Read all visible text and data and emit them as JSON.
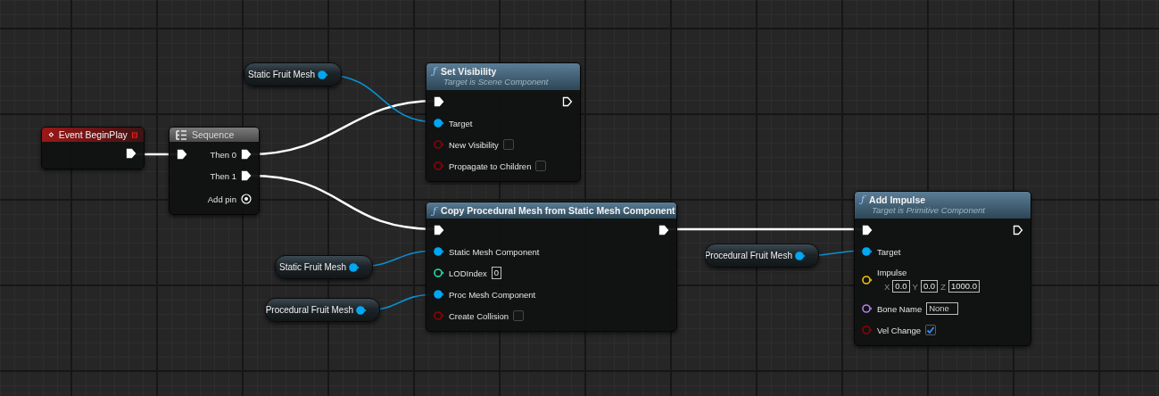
{
  "nodes": [
    {
      "kind": "variable",
      "title": "Static Fruit Mesh",
      "outputs": [
        {
          "kind": "object",
          "connected": true
        }
      ]
    },
    {
      "kind": "function",
      "icon_glyph": "ƒ",
      "title": "Set Visibility",
      "subtitle": "Target is Scene Component",
      "inputs": [
        {
          "kind": "exec",
          "connected": true
        },
        {
          "kind": "object",
          "label": "Target",
          "connected": true
        },
        {
          "kind": "bool",
          "label": "New Visibility",
          "connected": false,
          "checked": false
        },
        {
          "kind": "bool",
          "label": "Propagate to Children",
          "connected": false,
          "checked": false
        }
      ],
      "outputs": [
        {
          "kind": "exec",
          "connected": false
        }
      ]
    },
    {
      "kind": "event",
      "title": "Event BeginPlay",
      "outputs": [
        {
          "kind": "exec",
          "connected": true
        }
      ]
    },
    {
      "kind": "sequence",
      "title": "Sequence",
      "inputs": [
        {
          "kind": "exec",
          "connected": true
        }
      ],
      "outputs": [
        {
          "kind": "exec",
          "label": "Then 0",
          "connected": true
        },
        {
          "kind": "exec",
          "label": "Then 1",
          "connected": true
        },
        {
          "kind": "add",
          "label": "Add pin",
          "connected": false
        }
      ]
    },
    {
      "kind": "variable",
      "title": "Static Fruit Mesh",
      "outputs": [
        {
          "kind": "object",
          "connected": true
        }
      ]
    },
    {
      "kind": "variable",
      "title": "Procedural Fruit Mesh",
      "outputs": [
        {
          "kind": "object",
          "connected": true
        }
      ]
    },
    {
      "kind": "function",
      "icon_glyph": "ƒ",
      "title": "Copy Procedural Mesh from Static Mesh Component",
      "inputs": [
        {
          "kind": "exec",
          "connected": true
        },
        {
          "kind": "object",
          "label": "Static Mesh Component",
          "connected": true
        },
        {
          "kind": "int",
          "label": "LODIndex",
          "connected": false,
          "value": "0"
        },
        {
          "kind": "object",
          "label": "Proc Mesh Component",
          "connected": true
        },
        {
          "kind": "bool",
          "label": "Create Collision",
          "connected": false,
          "checked": false
        }
      ],
      "outputs": [
        {
          "kind": "exec",
          "connected": true
        }
      ]
    },
    {
      "kind": "variable",
      "title": "Procedural Fruit Mesh",
      "outputs": [
        {
          "kind": "object",
          "connected": true
        }
      ]
    },
    {
      "kind": "function",
      "icon_glyph": "ƒ",
      "title": "Add Impulse",
      "subtitle": "Target is Primitive Component",
      "inputs": [
        {
          "kind": "exec",
          "connected": true
        },
        {
          "kind": "object",
          "label": "Target",
          "connected": true
        },
        {
          "kind": "vector",
          "label": "Impulse",
          "connected": false,
          "values": [
            {
              "axis": "X",
              "value": "0.0"
            },
            {
              "axis": "Y",
              "value": "0.0"
            },
            {
              "axis": "Z",
              "value": "1000.0"
            }
          ]
        },
        {
          "kind": "name",
          "label": "Bone Name",
          "connected": false,
          "value": "None"
        },
        {
          "kind": "bool",
          "label": "Vel Change",
          "connected": false,
          "checked": true
        }
      ],
      "outputs": [
        {
          "kind": "exec",
          "connected": false
        }
      ]
    }
  ]
}
